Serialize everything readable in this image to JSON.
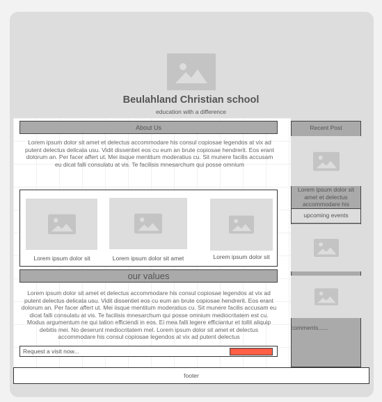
{
  "header": {
    "title": "Beulahland Christian school",
    "subtitle": "education with a difference",
    "logo_icon": "image-placeholder-icon"
  },
  "about": {
    "heading": "About Us",
    "text": "Lorem ipsum dolor sit amet et delectus accommodare his consul copiosae legendos at vix ad putent delectus delicata usu. Vidit dissentiet eos cu eum an brute copiosae hendrerit. Eos erant dolorum an. Per facer affert ut. Mei iisque mentitum moderatius cu. Sit munere facilis accusam eu dicat falli consulatu at vis. Te facilisis mnesarchum qui posse omnium"
  },
  "gallery": [
    {
      "caption": "Lorem ipsum dolor sit"
    },
    {
      "caption": "Lorem ipsum dolor sit amet"
    },
    {
      "caption": "Lorem ipsum dolor sit"
    }
  ],
  "values": {
    "heading": "our values",
    "text": "Lorem ipsum dolor sit amet et delectus accommodare his consul copiosae legendos at vix ad putent delectus delicata usu. Vidit dissentiet eos cu eum an brute copiosae hendrerit. Eos erant dolorum an. Per facer affert ut. Mei iisque mentitum moderatius cu. Sit munere facilis accusam eu dicat falli consulatu at vis. Te facilisis mnesarchum qui posse omnium mediocritatem est cu. Modus argumentum ne qui tation efficiendi in eos. Ei mea falli legere efficiantur et tollit aliquip debitis mei. No deserunt mediocritatem mel. Lorem ipsum dolor sit amet et delectus accommodare his consul copiosae legendos at vix ad putent delectus"
  },
  "request": {
    "placeholder": "Request a visit now...",
    "button_color": "#ff5f45"
  },
  "sidebar": {
    "recent_heading": "Recent Post",
    "recent_text": "Lorem ipsum dolor sit amet et delectus accommodare his",
    "events_heading": "upcoming events",
    "comments": "comments......"
  },
  "footer": {
    "label": "footer"
  }
}
